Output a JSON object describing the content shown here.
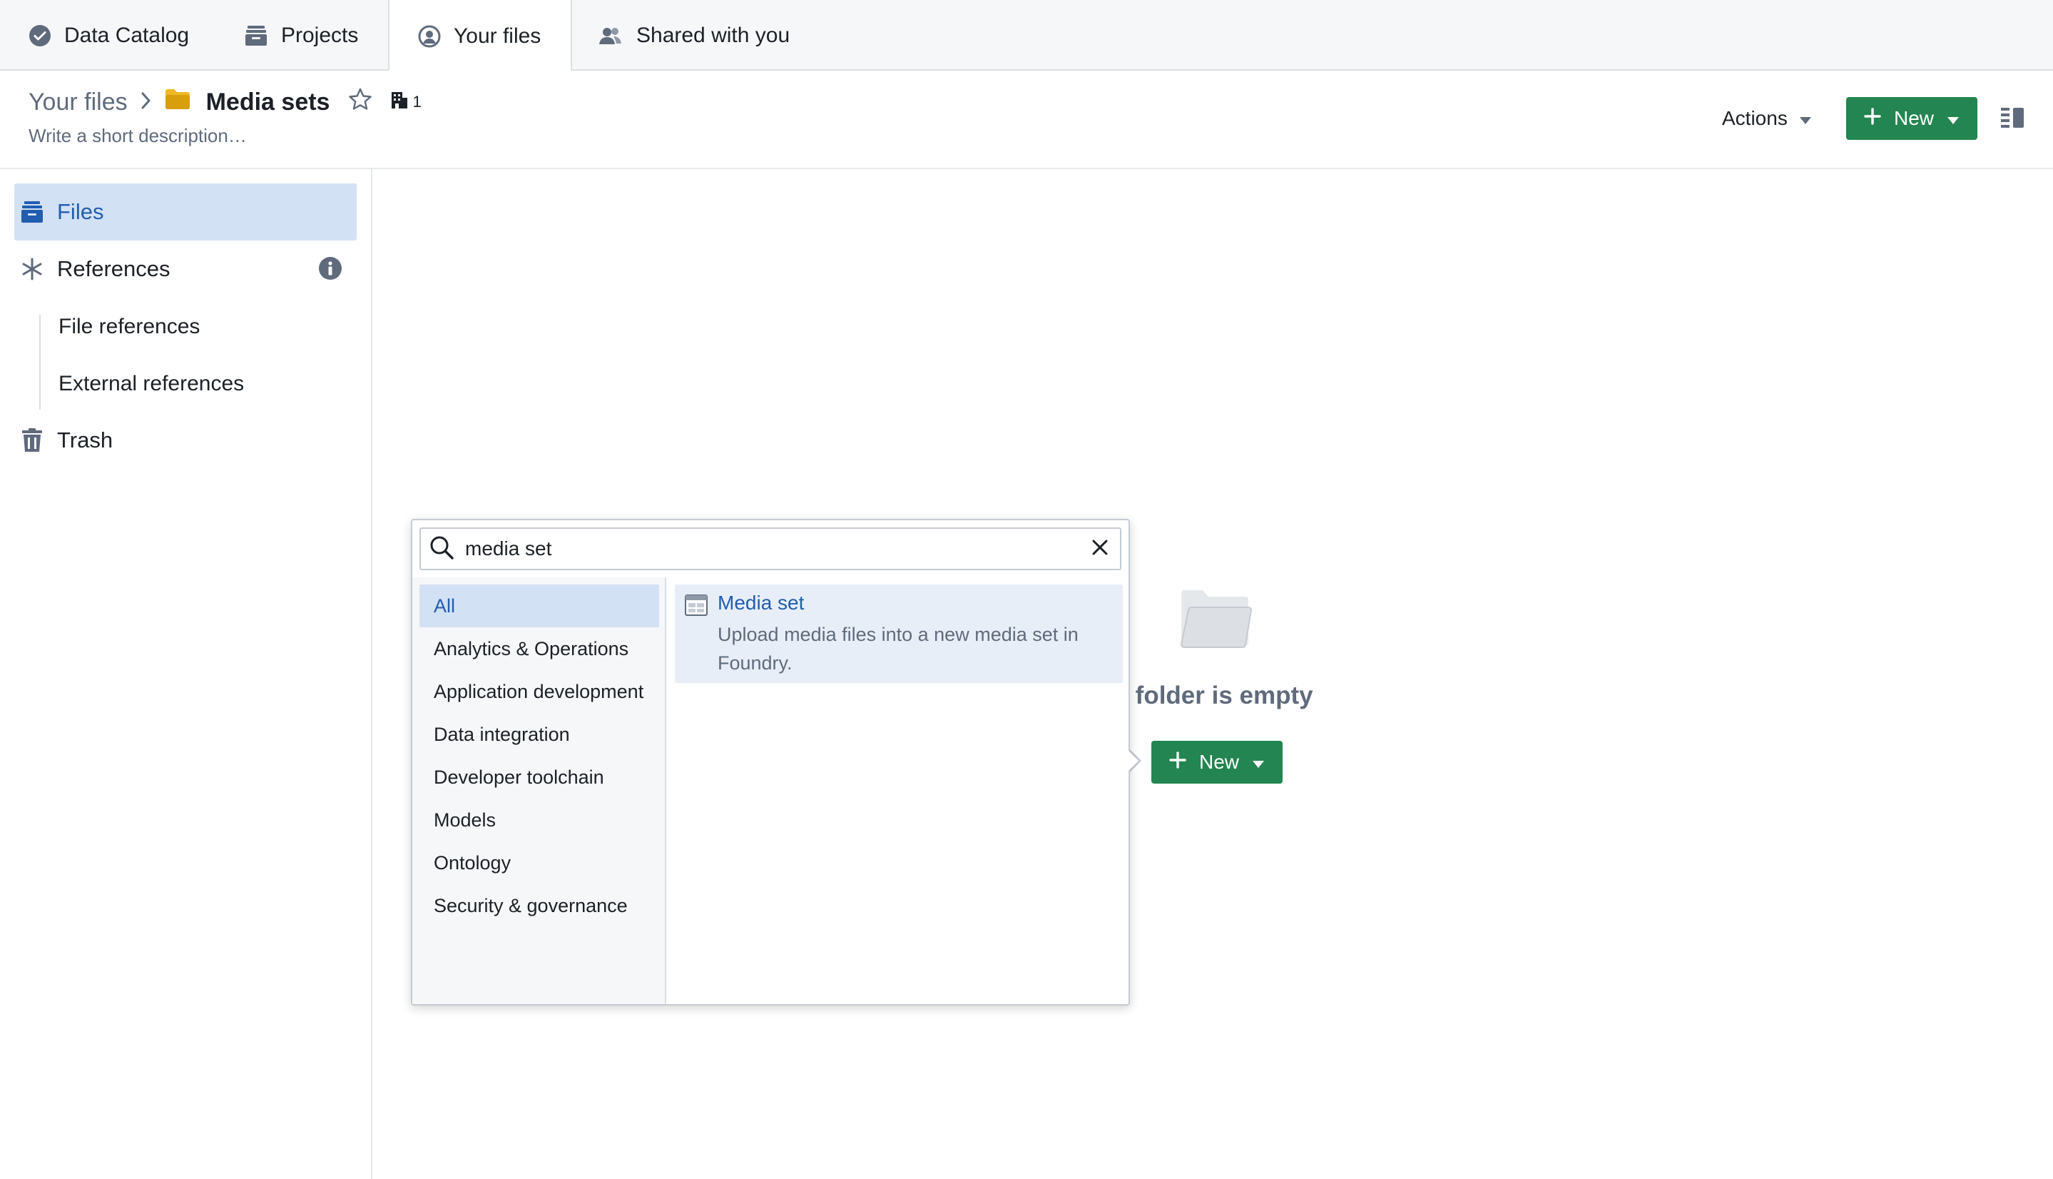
{
  "tabs": [
    {
      "label": "Data Catalog",
      "icon": "check-badge-icon"
    },
    {
      "label": "Projects",
      "icon": "archive-icon"
    },
    {
      "label": "Your files",
      "icon": "user-circle-icon",
      "active": true
    },
    {
      "label": "Shared with you",
      "icon": "people-icon"
    }
  ],
  "header": {
    "breadcrumb_root": "Your files",
    "title": "Media sets",
    "org_count": "1",
    "description_placeholder": "Write a short description…",
    "actions_label": "Actions",
    "new_label": "New"
  },
  "sidebar": {
    "files": "Files",
    "references": "References",
    "file_references": "File references",
    "external_references": "External references",
    "trash": "Trash"
  },
  "empty_state": {
    "text": "This folder is empty",
    "new_label": "New"
  },
  "popover": {
    "search_value": "media set",
    "categories": [
      "All",
      "Analytics & Operations",
      "Application development",
      "Data integration",
      "Developer toolchain",
      "Models",
      "Ontology",
      "Security & governance"
    ],
    "selected_category": "All",
    "result": {
      "title": "Media set",
      "description": "Upload media files into a new media set in Foundry."
    }
  },
  "colors": {
    "primary_green": "#238551",
    "selection_blue": "#d3e1f5",
    "link_blue": "#215db0",
    "folder_yellow": "#f0b726"
  }
}
